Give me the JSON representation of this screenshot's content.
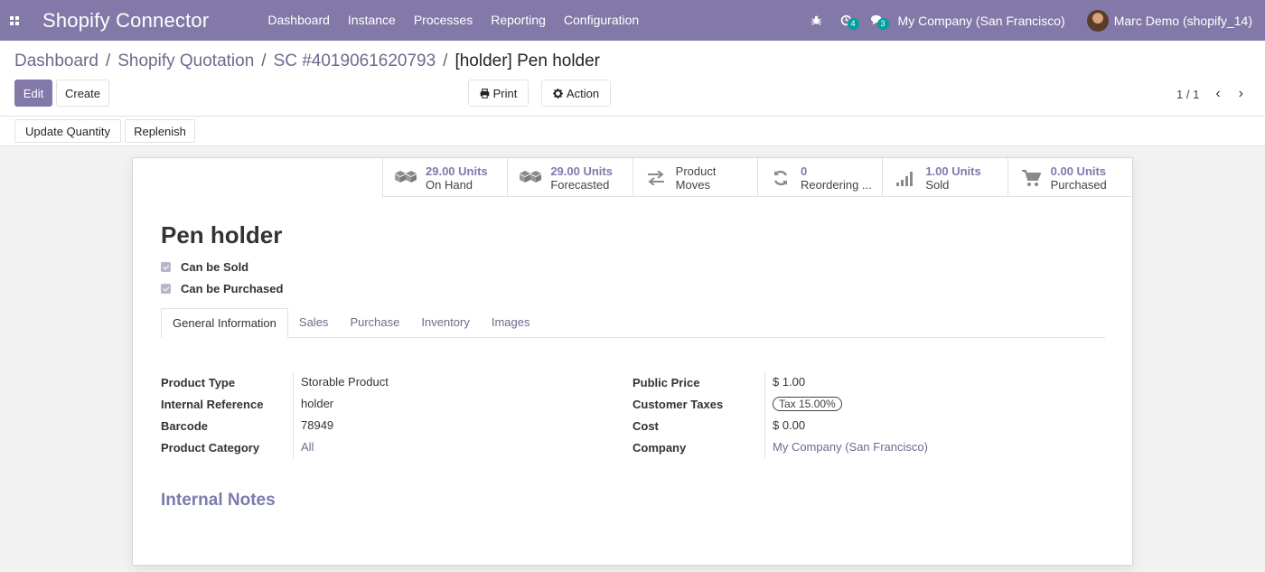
{
  "navbar": {
    "app_title": "Shopify Connector",
    "menu": [
      "Dashboard",
      "Instance",
      "Processes",
      "Reporting",
      "Configuration"
    ],
    "activity_count": "4",
    "messages_count": "3",
    "company": "My Company (San Francisco)",
    "user": "Marc Demo (shopify_14)",
    "accent_color": "#8379a8"
  },
  "breadcrumb": {
    "items": [
      "Dashboard",
      "Shopify Quotation",
      "SC #4019061620793"
    ],
    "current": "[holder] Pen holder"
  },
  "toolbar": {
    "edit_label": "Edit",
    "create_label": "Create",
    "print_label": "Print",
    "action_label": "Action",
    "pager": "1 / 1"
  },
  "statusbar": {
    "update_quantity_label": "Update Quantity",
    "replenish_label": "Replenish"
  },
  "smart_buttons": [
    {
      "icon": "cubes-icon",
      "value": "29.00 Units",
      "label": "On Hand"
    },
    {
      "icon": "cubes-icon",
      "value": "29.00 Units",
      "label": "Forecasted"
    },
    {
      "icon": "exchange-icon",
      "value": "Product",
      "label": "Moves"
    },
    {
      "icon": "refresh-icon",
      "value": "0",
      "label": "Reordering ..."
    },
    {
      "icon": "signal-icon",
      "value": "1.00 Units",
      "label": "Sold"
    },
    {
      "icon": "cart-icon",
      "value": "0.00 Units",
      "label": "Purchased"
    }
  ],
  "product": {
    "name": "Pen holder",
    "can_be_sold": "Can be Sold",
    "can_be_purchased": "Can be Purchased"
  },
  "tabs": [
    "General Information",
    "Sales",
    "Purchase",
    "Inventory",
    "Images"
  ],
  "fields_left": [
    {
      "label": "Product Type",
      "value": "Storable Product"
    },
    {
      "label": "Internal Reference",
      "value": "holder"
    },
    {
      "label": "Barcode",
      "value": "78949"
    },
    {
      "label": "Product Category",
      "value": "All"
    }
  ],
  "fields_right": [
    {
      "label": "Public Price",
      "value": "$ 1.00"
    },
    {
      "label": "Customer Taxes",
      "value": "Tax 15.00%"
    },
    {
      "label": "Cost",
      "value": "$ 0.00"
    },
    {
      "label": "Company",
      "value": "My Company (San Francisco)"
    }
  ],
  "notes_title": "Internal Notes"
}
